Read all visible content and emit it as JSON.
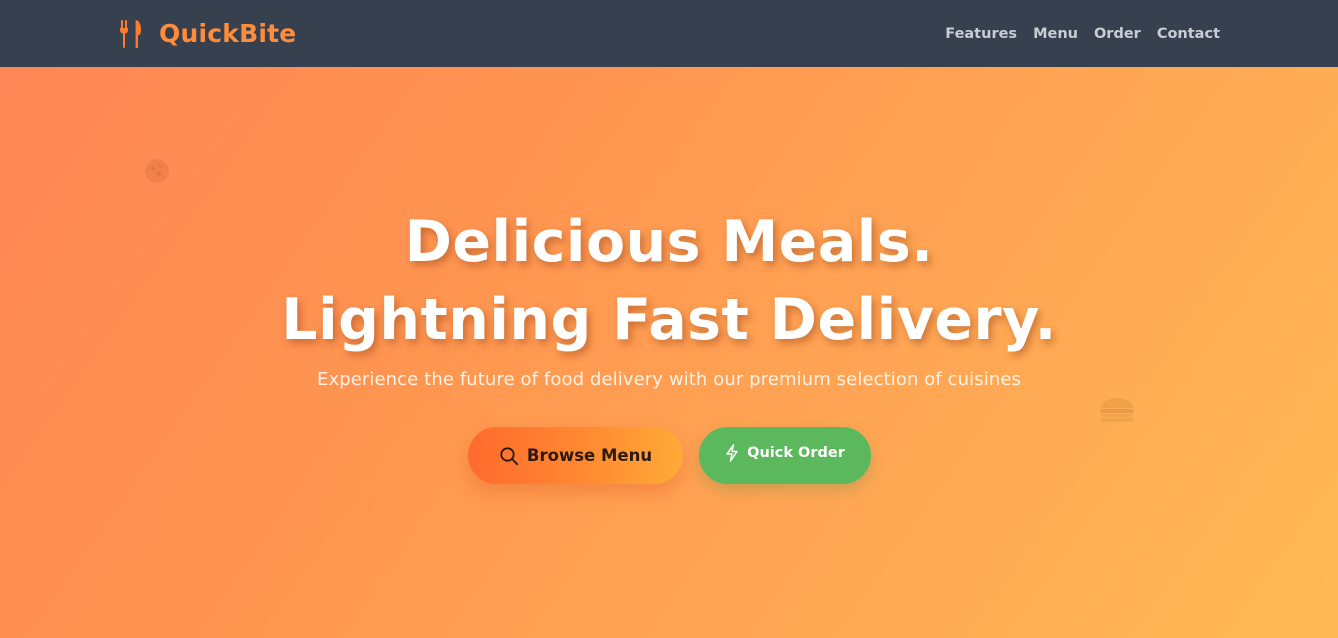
{
  "nav": {
    "brand": "QuickBite",
    "logo_icon": "utensils-icon",
    "links": [
      "Features",
      "Menu",
      "Order",
      "Contact"
    ]
  },
  "hero": {
    "headline_line1": "Delicious Meals.",
    "headline_line2": "Lightning Fast Delivery.",
    "subtitle": "Experience the future of food delivery with our premium selection of cuisines",
    "browse_button": {
      "label": "Browse Menu",
      "icon": "search-icon"
    },
    "quick_button": {
      "label": "Quick Order",
      "icon": "bolt-icon"
    },
    "decorations": [
      "pizza-icon",
      "burger-icon"
    ]
  },
  "colors": {
    "navbar_bg": "#36404f",
    "brand": "#ff8c3a",
    "nav_link": "#c9cdd3",
    "hero_start": "#ff8656",
    "hero_end": "#ffb954",
    "browse_button": "#ff7a30",
    "quick_button": "#5cb85c"
  }
}
